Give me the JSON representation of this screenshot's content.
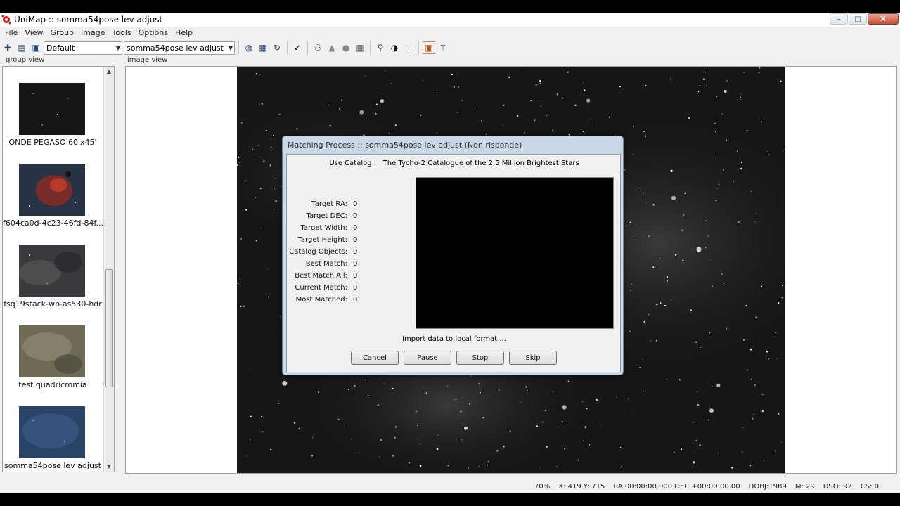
{
  "window": {
    "title": "UniMap :: somma54pose lev adjust",
    "minimize": "–",
    "maximize": "□",
    "close": "X"
  },
  "menu": [
    "File",
    "View",
    "Group",
    "Image",
    "Tools",
    "Options",
    "Help"
  ],
  "toolbar": {
    "profile_select": "Default",
    "image_select": "somma54pose lev adjust"
  },
  "group_view": {
    "label": "group view",
    "items": [
      {
        "name": "ONDE PEGASO 60'x45'",
        "color": "#161616"
      },
      {
        "name": "f604ca0d-4c23-46fd-84f...",
        "color": "#3a2a3a"
      },
      {
        "name": "fsq19stack-wb-as530-hdr",
        "color": "#3c3c40"
      },
      {
        "name": "test quadricromia",
        "color": "#6b6650"
      },
      {
        "name": "somma54pose lev adjust",
        "color": "#2a4468"
      }
    ]
  },
  "image_view": {
    "label": "image view"
  },
  "dialog": {
    "title": "Matching Process :: somma54pose lev adjust (Non risponde)",
    "catalog_label": "Use Catalog:",
    "catalog_name": "The Tycho-2 Catalogue of the 2.5 Million Brightest Stars",
    "stats": [
      {
        "label": "Target RA:",
        "value": "0"
      },
      {
        "label": "Target DEC:",
        "value": "0"
      },
      {
        "label": "Target Width:",
        "value": "0"
      },
      {
        "label": "Target Height:",
        "value": "0"
      },
      {
        "label": "Catalog Objects:",
        "value": "0"
      },
      {
        "label": "Best Match:",
        "value": "0"
      },
      {
        "label": "Best Match All:",
        "value": "0"
      },
      {
        "label": "Current Match:",
        "value": "0"
      },
      {
        "label": "Most Matched:",
        "value": "0"
      }
    ],
    "status": "Import data to local format ...",
    "buttons": {
      "cancel": "Cancel",
      "pause": "Pause",
      "stop": "Stop",
      "skip": "Skip"
    }
  },
  "statusbar": {
    "zoom": "70%",
    "coords": "X: 419 Y: 715",
    "radec": "RA  00:00:00.000 DEC +00:00:00.00",
    "dobj": "DOBJ:1989",
    "m": "M:  29",
    "dso": "DSO:  92",
    "cs": "CS:   0"
  }
}
